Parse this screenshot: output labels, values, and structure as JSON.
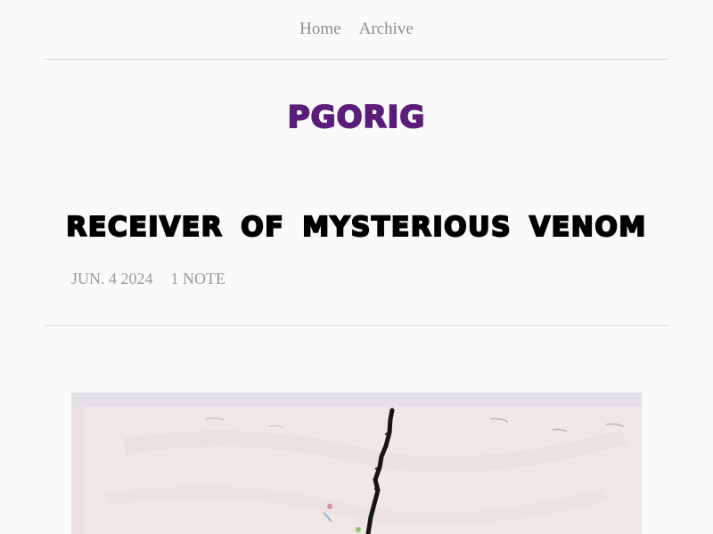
{
  "nav": {
    "items": [
      {
        "label": "Home"
      },
      {
        "label": "Archive"
      }
    ]
  },
  "blog": {
    "title": "PGORIG",
    "accent_color": "#5a1e7a"
  },
  "post": {
    "title": "RECEIVER OF MYSTERIOUS VENOM",
    "date": "JUN. 4 2024",
    "notes": "1 NOTE",
    "image_icon": "artwork-image"
  }
}
